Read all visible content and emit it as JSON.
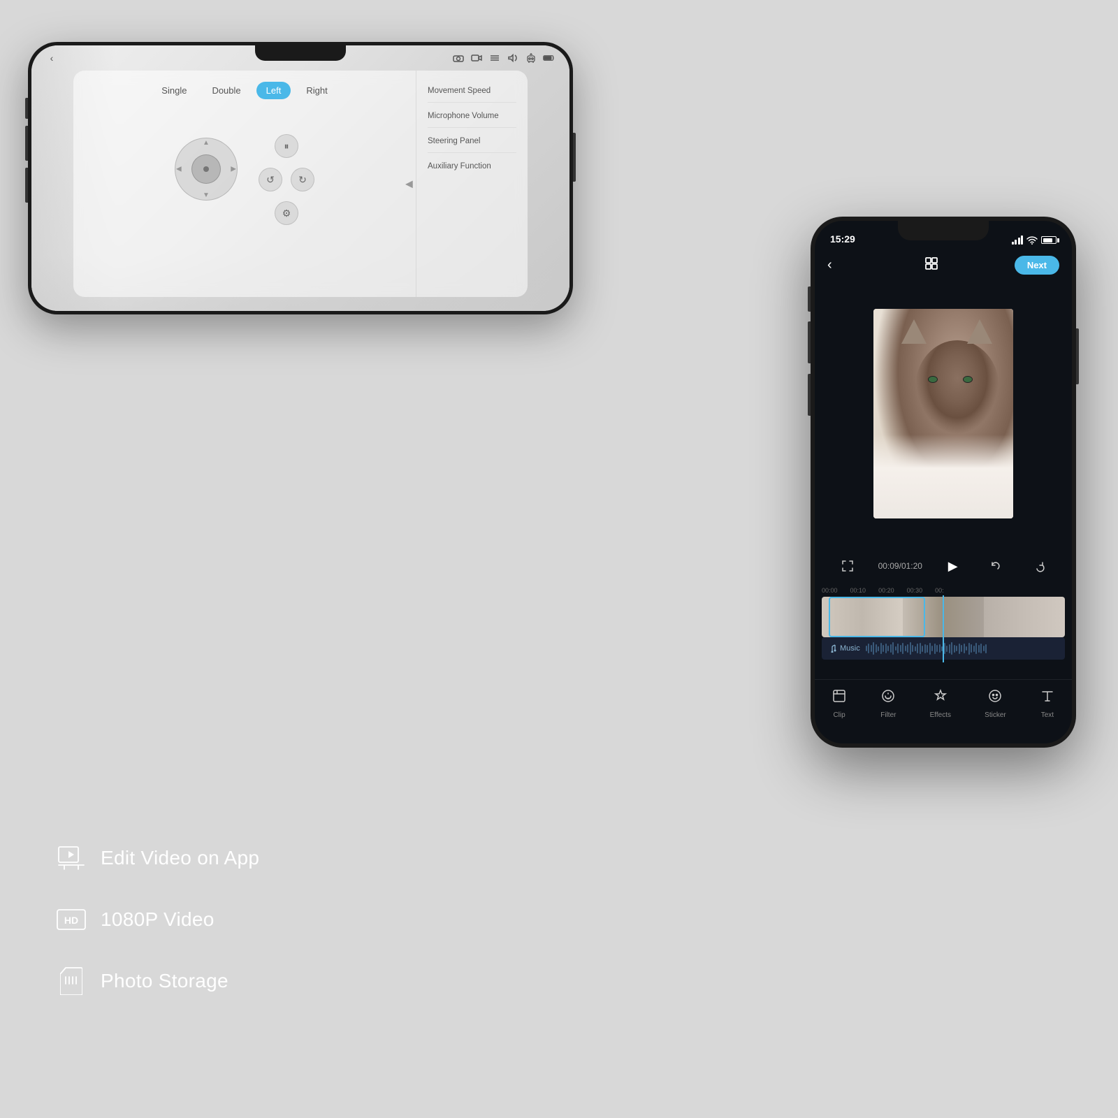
{
  "background_color": "#d8d8d8",
  "phone1": {
    "mode_buttons": [
      {
        "label": "Single",
        "active": false
      },
      {
        "label": "Double",
        "active": false
      },
      {
        "label": "Left",
        "active": true
      },
      {
        "label": "Right",
        "active": false
      }
    ],
    "menu_items": [
      {
        "label": "Movement\nSpeed"
      },
      {
        "label": "Microphone\nVolume"
      },
      {
        "label": "Steering\nPanel"
      },
      {
        "label": "Auxiliary\nFunction"
      }
    ],
    "status_icons": [
      "camera",
      "video",
      "list",
      "speaker",
      "user",
      "battery"
    ]
  },
  "phone2": {
    "time": "15:29",
    "next_label": "Next",
    "timecode": "00:09/01:20",
    "timeline_marks": [
      "00:00",
      "00:10",
      "00:20",
      "00:30",
      "00:"
    ],
    "music_label": "Music",
    "toolbar_items": [
      {
        "label": "Clip",
        "icon": "clip"
      },
      {
        "label": "Filter",
        "icon": "filter"
      },
      {
        "label": "Effects",
        "icon": "effects"
      },
      {
        "label": "Sticker",
        "icon": "sticker"
      },
      {
        "label": "Text",
        "icon": "text"
      }
    ]
  },
  "features": [
    {
      "label": "Edit Video on App",
      "icon": "video-edit"
    },
    {
      "label": "1080P Video",
      "icon": "hd"
    },
    {
      "label": "Photo Storage",
      "icon": "sd-card"
    }
  ]
}
